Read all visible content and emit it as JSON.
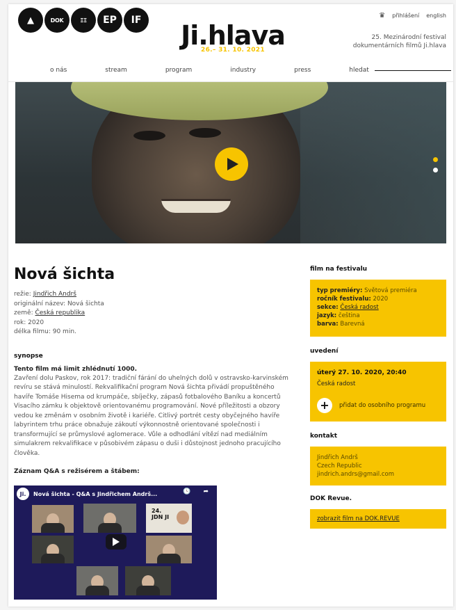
{
  "header": {
    "logos": [
      "▲",
      "DOK",
      "ΞΞ",
      "EP",
      "IF"
    ],
    "brand_name": "Ji.hlava",
    "brand_dates": "26.– 31. 10. 2021",
    "login": "přihlášení",
    "lang": "english",
    "festival_info_1": "25. Mezinárodní festival",
    "festival_info_2": "dokumentárních filmů Ji.hlava"
  },
  "nav": {
    "items": [
      "o nás",
      "stream",
      "program",
      "industry",
      "press"
    ],
    "search": "hledat"
  },
  "film": {
    "title": "Nová šichta",
    "director_label": "režie:",
    "director": "Jindřich Andrš",
    "original_title_label": "originální název:",
    "original_title": "Nová šichta",
    "country_label": "země:",
    "country": "Česká republika",
    "year_label": "rok:",
    "year": "2020",
    "length_label": "délka filmu:",
    "length": "90 min."
  },
  "synopsis": {
    "heading": "synopse",
    "lead": "Tento film má limit zhlédnutí 1000.",
    "body": "Zavření dolu Paskov, rok 2017: tradiční fárání do uhelných dolů v ostravsko-karvinském revíru se stává minulostí. Rekvalifikační program Nová šichta přivádí propuštěného havíře Tomáše Hisema od krumpáče, sbíječky, zápasů fotbalového Baníku a koncertů Visacího zámku k objektově orientovanému programování. Nové příležitosti a obzory vedou ke změnám v osobním životě i kariéře. Citlivý portrét cesty obyčejného havíře labyrintem trhu práce obnažuje zákoutí výkonnostně orientované společnosti i transformující se průmyslové aglomerace. Vůle a odhodlání vítězí nad mediálním simulakrem rekvalifikace v působivém zápasu o duši i důstojnost jednoho pracujícího člověka."
  },
  "qa": {
    "heading": "Záznam Q&A s režisérem a štábem:",
    "video_logo": "Ji.",
    "video_title": "Nová šichta - Q&A s Jindřichem Andrš...",
    "watch_later": "Později",
    "share": "Sdílet",
    "slide_text": "24. JDN JI"
  },
  "sidebar": {
    "festival_heading": "film na festivalu",
    "premiere_label": "typ premiéry:",
    "premiere": "Světová premiéra",
    "year_label": "ročník festivalu:",
    "year": "2020",
    "section_label": "sekce:",
    "section": "Česká radost",
    "language_label": "jazyk:",
    "language": "čeština",
    "color_label": "barva:",
    "color": "Barevná",
    "screening_heading": "uvedení",
    "screening_date": "úterý 27. 10. 2020, 20:40",
    "screening_section": "Česká radost",
    "add_program": "přidat do osobního programu",
    "contact_heading": "kontakt",
    "contact_name": "Jindřich Andrš",
    "contact_country": "Czech Republic",
    "contact_email": "jindrich.andrs@gmail.com",
    "dok_heading": "DOK Revue.",
    "dok_link": "zobrazit film na DOK.REVUE"
  },
  "colors": {
    "accent": "#f7c400",
    "video_bg": "#1e1a5a"
  }
}
